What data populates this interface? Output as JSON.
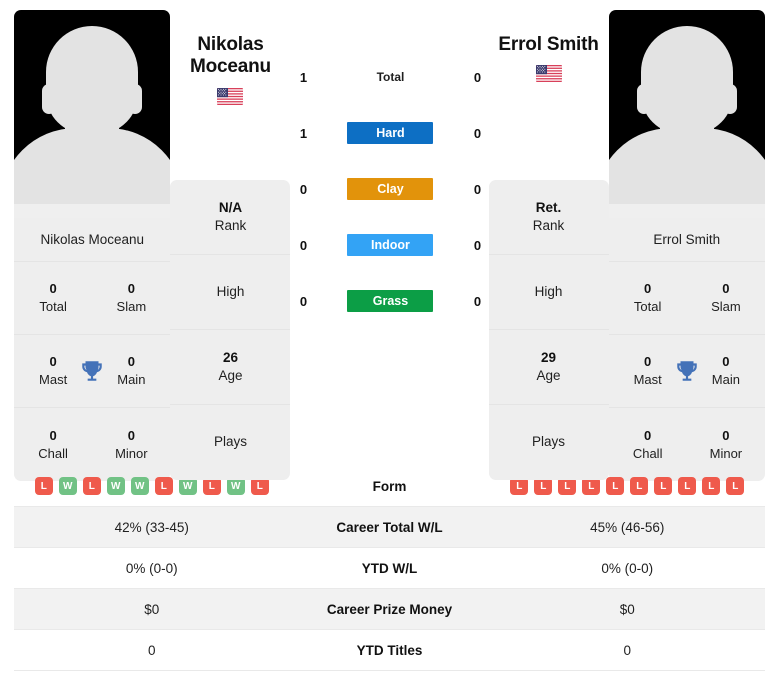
{
  "players": {
    "left": {
      "display_name_line1": "Nikolas",
      "display_name_line2": "Moceanu",
      "card_name": "Nikolas Moceanu",
      "flag": "us-flag-icon",
      "titles": [
        {
          "value": "0",
          "label": "Total"
        },
        {
          "value": "0",
          "label": "Slam"
        },
        {
          "value": "0",
          "label": "Mast"
        },
        {
          "value": "0",
          "label": "Main"
        },
        {
          "value": "0",
          "label": "Chall"
        },
        {
          "value": "0",
          "label": "Minor"
        }
      ],
      "info": [
        {
          "value": "N/A",
          "label": "Rank"
        },
        {
          "value": "",
          "label": "High"
        },
        {
          "value": "26",
          "label": "Age"
        },
        {
          "value": "",
          "label": "Plays"
        }
      ],
      "form": [
        "L",
        "W",
        "L",
        "W",
        "W",
        "L",
        "W",
        "L",
        "W",
        "L"
      ],
      "career_total_wl": "42% (33-45)",
      "ytd_wl": "0% (0-0)",
      "career_prize_money": "$0",
      "ytd_titles": "0"
    },
    "right": {
      "display_name_line1": "Errol Smith",
      "display_name_line2": "",
      "card_name": "Errol Smith",
      "flag": "us-flag-icon",
      "titles": [
        {
          "value": "0",
          "label": "Total"
        },
        {
          "value": "0",
          "label": "Slam"
        },
        {
          "value": "0",
          "label": "Mast"
        },
        {
          "value": "0",
          "label": "Main"
        },
        {
          "value": "0",
          "label": "Chall"
        },
        {
          "value": "0",
          "label": "Minor"
        }
      ],
      "info": [
        {
          "value": "Ret.",
          "label": "Rank"
        },
        {
          "value": "",
          "label": "High"
        },
        {
          "value": "29",
          "label": "Age"
        },
        {
          "value": "",
          "label": "Plays"
        }
      ],
      "form": [
        "L",
        "L",
        "L",
        "L",
        "L",
        "L",
        "L",
        "L",
        "L",
        "L"
      ],
      "career_total_wl": "45% (46-56)",
      "ytd_wl": "0% (0-0)",
      "career_prize_money": "$0",
      "ytd_titles": "0"
    }
  },
  "head_to_head": [
    {
      "label": "Total",
      "left": "1",
      "right": "0",
      "color": "transparent",
      "text_color": "#1f1f1f"
    },
    {
      "label": "Hard",
      "left": "1",
      "right": "0",
      "color": "#0d6fc4",
      "text_color": "#ffffff"
    },
    {
      "label": "Clay",
      "left": "0",
      "right": "0",
      "color": "#e2930b",
      "text_color": "#ffffff"
    },
    {
      "label": "Indoor",
      "left": "0",
      "right": "0",
      "color": "#33a3f5",
      "text_color": "#ffffff"
    },
    {
      "label": "Grass",
      "left": "0",
      "right": "0",
      "color": "#0c9e46",
      "text_color": "#ffffff"
    }
  ],
  "stats_rows": [
    {
      "label": "Form",
      "type": "form"
    },
    {
      "label": "Career Total W/L",
      "type": "text",
      "key": "career_total_wl"
    },
    {
      "label": "YTD W/L",
      "type": "text",
      "key": "ytd_wl"
    },
    {
      "label": "Career Prize Money",
      "type": "text",
      "key": "career_prize_money"
    },
    {
      "label": "YTD Titles",
      "type": "text",
      "key": "ytd_titles"
    }
  ],
  "colors": {
    "win": "#71c285",
    "loss": "#ef5a4c",
    "trophy": "#4472b8",
    "card_bg": "#eeeeee",
    "stripe_bg": "#f2f2f2"
  }
}
